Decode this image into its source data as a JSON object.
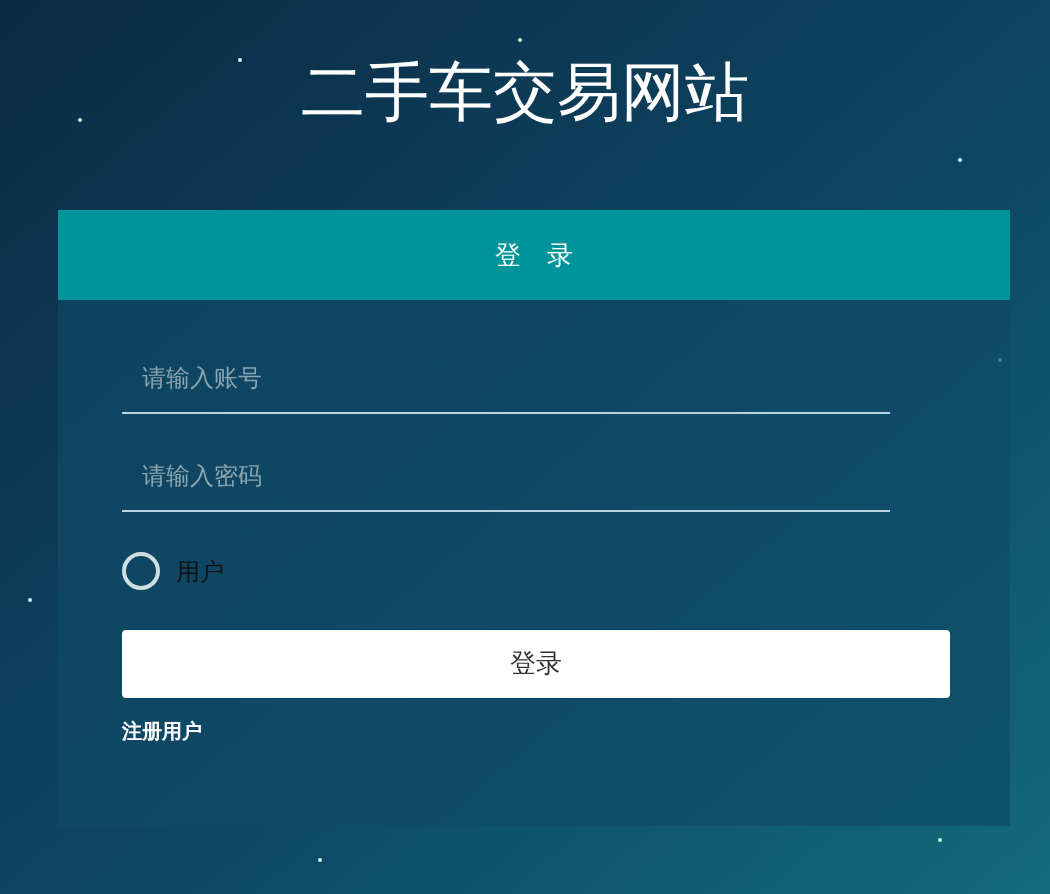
{
  "title": "二手车交易网站",
  "panel": {
    "header": "登　录",
    "fields": [
      {
        "placeholder": "请输入账号"
      },
      {
        "placeholder": "请输入密码"
      }
    ],
    "roles": [
      {
        "label": "用户",
        "selected": false
      }
    ],
    "submit": "登录",
    "register_link": "注册用户"
  }
}
